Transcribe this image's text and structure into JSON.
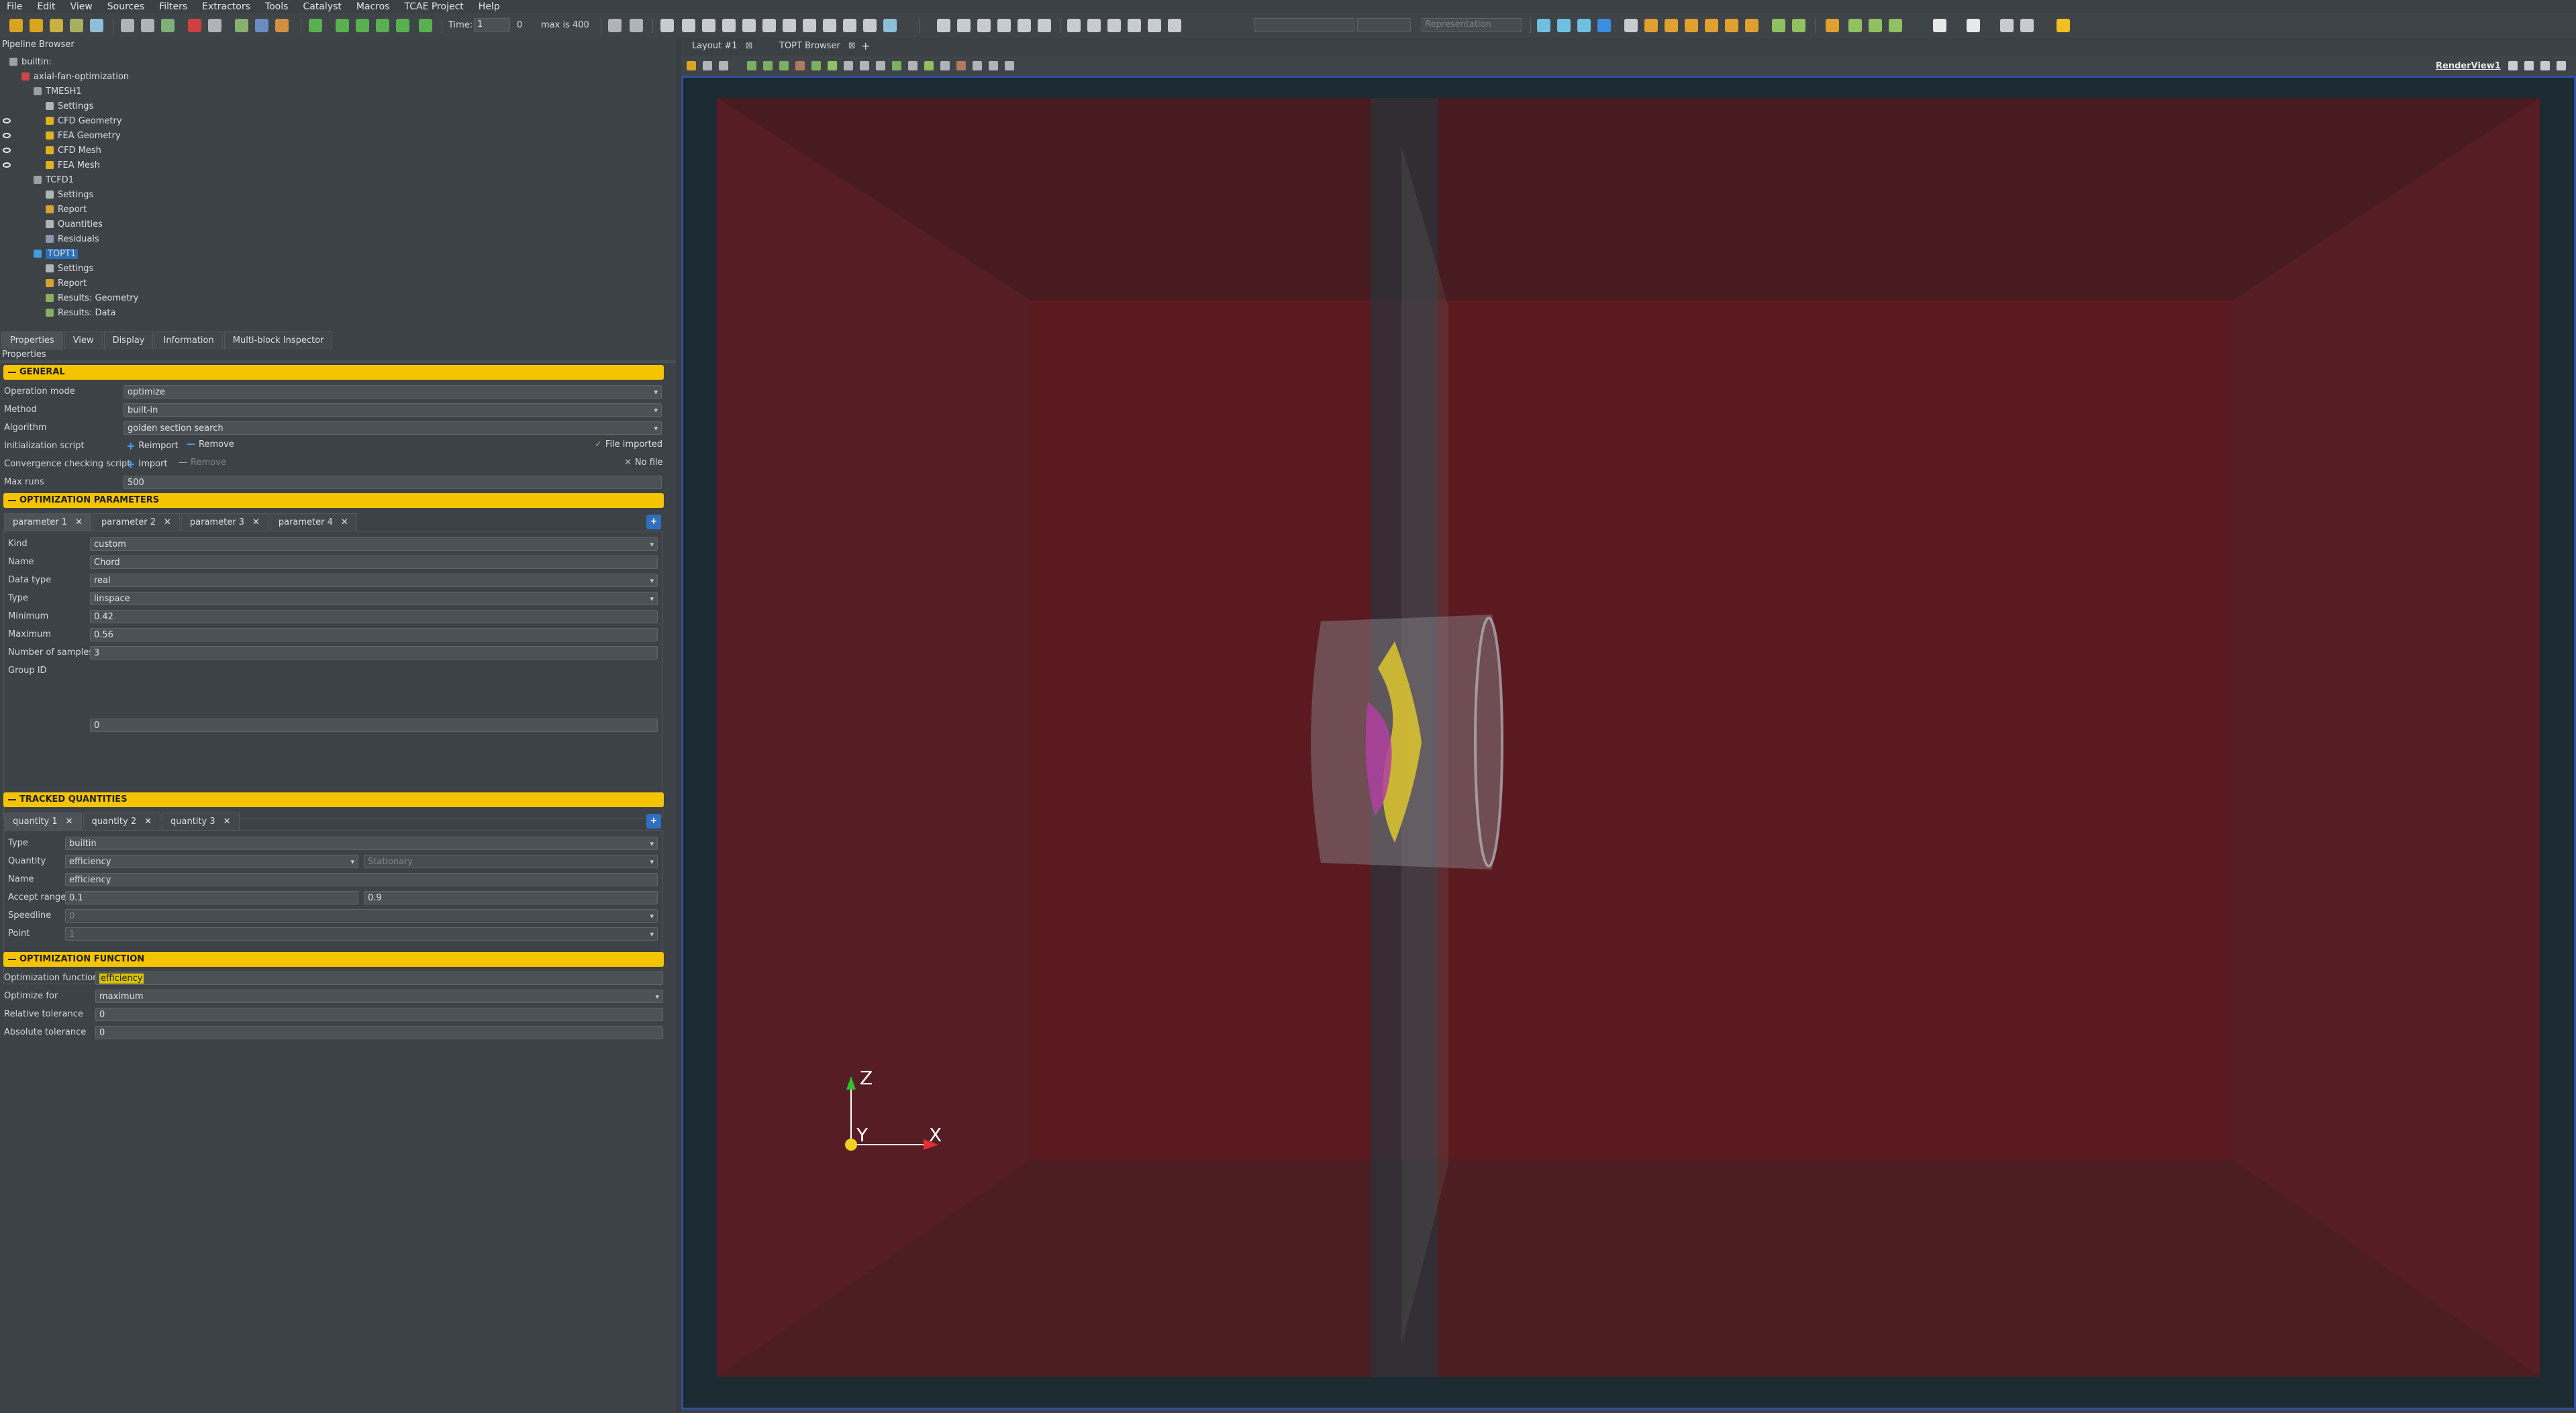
{
  "menubar": [
    "File",
    "Edit",
    "View",
    "Sources",
    "Filters",
    "Extractors",
    "Tools",
    "Catalyst",
    "Macros",
    "TCAE Project",
    "Help"
  ],
  "toolbar": {
    "time_label": "Time:",
    "time_value": "1",
    "time_index": "0",
    "max_label": "max is 400",
    "representation": "Representation"
  },
  "pipeline": {
    "title": "Pipeline Browser",
    "items": [
      {
        "label": "builtin:",
        "level": 0
      },
      {
        "label": "axial-fan-optimization",
        "level": 1
      },
      {
        "label": "TMESH1",
        "level": 2
      },
      {
        "label": "Settings",
        "level": 3
      },
      {
        "label": "CFD Geometry",
        "level": 3,
        "visible": true
      },
      {
        "label": "FEA Geometry",
        "level": 3,
        "visible": true
      },
      {
        "label": "CFD Mesh",
        "level": 3,
        "visible": true
      },
      {
        "label": "FEA Mesh",
        "level": 3,
        "visible": true
      },
      {
        "label": "TCFD1",
        "level": 2
      },
      {
        "label": "Settings",
        "level": 3
      },
      {
        "label": "Report",
        "level": 3
      },
      {
        "label": "Quantities",
        "level": 3
      },
      {
        "label": "Residuals",
        "level": 3
      },
      {
        "label": "TOPT1",
        "level": 2,
        "selected": true
      },
      {
        "label": "Settings",
        "level": 3
      },
      {
        "label": "Report",
        "level": 3
      },
      {
        "label": "Results: Geometry",
        "level": 3
      },
      {
        "label": "Results: Data",
        "level": 3
      }
    ]
  },
  "tabs": [
    "Properties",
    "View",
    "Display",
    "Information",
    "Multi-block Inspector"
  ],
  "properties": {
    "title": "Properties",
    "general": {
      "header": "GENERAL",
      "operation_mode_label": "Operation mode",
      "operation_mode": "optimize",
      "method_label": "Method",
      "method": "built-in",
      "algorithm_label": "Algorithm",
      "algorithm": "golden section search",
      "init_script_label": "Initialization script",
      "reimport": "Reimport",
      "remove": "Remove",
      "file_imported": "File imported",
      "conv_script_label": "Convergence checking script",
      "import": "Import",
      "remove2": "Remove",
      "no_file": "No file",
      "max_runs_label": "Max runs",
      "max_runs": "500"
    },
    "opt_params": {
      "header": "OPTIMIZATION PARAMETERS",
      "tabs": [
        "parameter 1",
        "parameter 2",
        "parameter 3",
        "parameter 4"
      ],
      "kind_label": "Kind",
      "kind": "custom",
      "name_label": "Name",
      "name": "Chord",
      "dtype_label": "Data type",
      "dtype": "real",
      "type_label": "Type",
      "type": "linspace",
      "min_label": "Minimum",
      "min": "0.42",
      "max_label": "Maximum",
      "max": "0.56",
      "samples_label": "Number of samples",
      "samples": "3",
      "group_label": "Group ID",
      "group": "0"
    },
    "tracked": {
      "header": "TRACKED QUANTITIES",
      "tabs": [
        "quantity 1",
        "quantity 2",
        "quantity 3"
      ],
      "type_label": "Type",
      "type": "builtin",
      "quantity_label": "Quantity",
      "quantity": "efficiency",
      "quantity2": "Stationary",
      "name_label": "Name",
      "name": "efficiency",
      "accept_label": "Accept range",
      "accept_min": "0.1",
      "accept_max": "0.9",
      "speedline_label": "Speedline",
      "speedline": "0",
      "point_label": "Point",
      "point": "1"
    },
    "opt_function": {
      "header": "OPTIMIZATION FUNCTION",
      "func_label": "Optimization function",
      "func": "efficiency",
      "optfor_label": "Optimize for",
      "optfor": "maximum",
      "reltol_label": "Relative tolerance",
      "reltol": "0",
      "abstol_label": "Absolute tolerance",
      "abstol": "0"
    }
  },
  "layout_tabs": [
    "Layout #1",
    "TOPT Browser"
  ],
  "render_view": "RenderView1",
  "axes": {
    "z": "Z",
    "y": "Y",
    "x": "X"
  }
}
